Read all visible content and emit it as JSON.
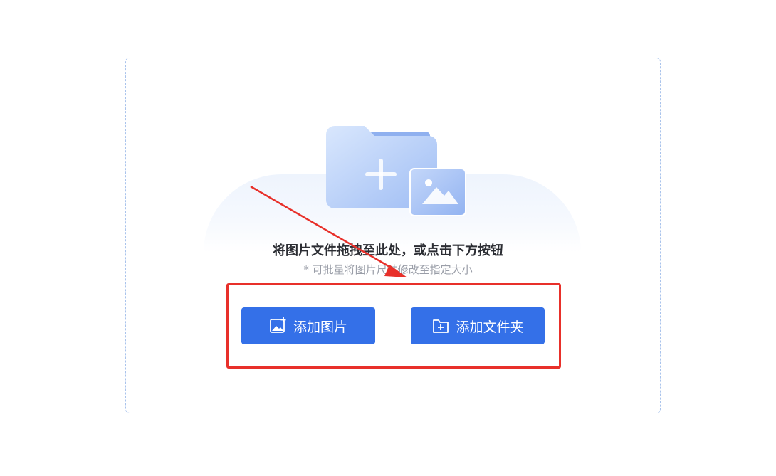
{
  "dropzone": {
    "title": "将图片文件拖拽至此处，或点击下方按钮",
    "subtitle": "* 可批量将图片尺寸修改至指定大小"
  },
  "buttons": {
    "add_image": {
      "label": "添加图片",
      "icon": "image-plus-icon"
    },
    "add_folder": {
      "label": "添加文件夹",
      "icon": "folder-plus-icon"
    }
  },
  "colors": {
    "button_bg": "#3470e8",
    "dashed_border": "#a9c3ec",
    "highlight": "#e8302a",
    "title_text": "#2b2d33",
    "subtitle_text": "#9a9ea8"
  },
  "illustration": {
    "icon": "folder-with-image-upload-illustration"
  }
}
